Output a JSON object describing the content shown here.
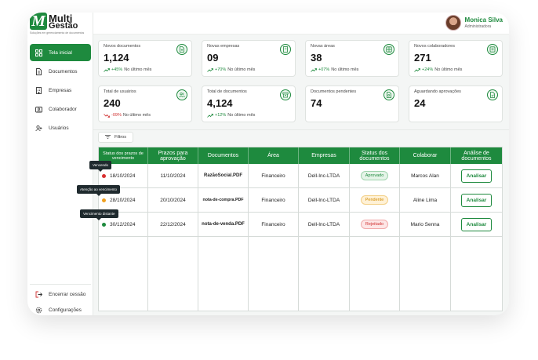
{
  "brand": {
    "logo_letter": "M",
    "name_line1": "Multi",
    "name_line2": "Gestão",
    "tagline": "Soluções em gerenciamento de documentos",
    "color": "#1e8a3e"
  },
  "user": {
    "name": "Monica Silva",
    "role": "Administradora"
  },
  "sidebar": {
    "items": [
      {
        "label": "Tela inicial",
        "icon": "grid-icon",
        "active": true
      },
      {
        "label": "Documentos",
        "icon": "document-icon",
        "active": false
      },
      {
        "label": "Empresas",
        "icon": "building-icon",
        "active": false
      },
      {
        "label": "Colaborador",
        "icon": "id-card-icon",
        "active": false
      },
      {
        "label": "Usuários",
        "icon": "user-add-icon",
        "active": false
      }
    ],
    "bottom": [
      {
        "label": "Encerrar cessão",
        "icon": "logout-icon"
      },
      {
        "label": "Configurações",
        "icon": "gear-icon"
      }
    ]
  },
  "cards": [
    {
      "title": "Novos documentos",
      "value": "1,124",
      "trend": "+45%",
      "trend_dir": "up",
      "period": "No último mês",
      "icon": "document-plus-icon"
    },
    {
      "title": "Novas empresas",
      "value": "09",
      "trend": "+70%",
      "trend_dir": "up",
      "period": "No último mês",
      "icon": "building-icon"
    },
    {
      "title": "Novas áreas",
      "value": "38",
      "trend": "+07%",
      "trend_dir": "up",
      "period": "No último mês",
      "icon": "grid-icon"
    },
    {
      "title": "Novos colaboradores",
      "value": "271",
      "trend": "+24%",
      "trend_dir": "up",
      "period": "No último mês",
      "icon": "id-card-icon"
    },
    {
      "title": "Total de usuários",
      "value": "240",
      "trend": "-09%",
      "trend_dir": "down",
      "period": "No último mês",
      "icon": "users-icon"
    },
    {
      "title": "Total de documentos",
      "value": "4,124",
      "trend": "+12%",
      "trend_dir": "up",
      "period": "No último mês",
      "icon": "archive-icon"
    },
    {
      "title": "Documentos pendentes",
      "value": "74",
      "trend": "",
      "trend_dir": "",
      "period": "",
      "icon": "document-search-icon"
    },
    {
      "title": "Aguardando aprovações",
      "value": "24",
      "trend": "",
      "trend_dir": "",
      "period": "",
      "icon": "document-check-icon"
    }
  ],
  "filters_label": "Filtros",
  "table": {
    "headers": [
      "Status dos prazos de vencimento",
      "Prazos para aprovação",
      "Documentos",
      "Área",
      "Empresas",
      "Status dos documentos",
      "Colaborar",
      "Análise de documentos"
    ],
    "rows": [
      {
        "due_date": "18/10/2024",
        "due_status": "overdue",
        "approval_date": "11/10/2024",
        "document": "RazãoSocial.PDF",
        "area": "Financeiro",
        "company": "Dell-Inc-LTDA",
        "status": "Aprovado",
        "status_type": "approved",
        "collaborator": "Marcos Alan",
        "action": "Analisar"
      },
      {
        "due_date": "28/10/2024",
        "due_status": "warning",
        "approval_date": "20/10/2024",
        "document": "nota-de-compra.PDF",
        "area": "Financeiro",
        "company": "Dell-Inc-LTDA",
        "status": "Pendente",
        "status_type": "pending",
        "collaborator": "Aline Lima",
        "action": "Analisar"
      },
      {
        "due_date": "30/12/2024",
        "due_status": "ok",
        "approval_date": "22/12/2024",
        "document": "nota-de-venda.PDF",
        "area": "Financeiro",
        "company": "Dell-Inc-LTDA",
        "status": "Rejeitado",
        "status_type": "rejected",
        "collaborator": "Mario Senna",
        "action": "Analisar"
      }
    ],
    "tooltips": [
      "Vencendo",
      "Atenção ao vencimento",
      "Vencimento distante"
    ]
  },
  "colors": {
    "primary": "#1e8a3e",
    "dot_overdue": "#d93030",
    "dot_warning": "#f0a020",
    "dot_ok": "#1e8a3e",
    "badge_approved_bg": "#e5f4e8",
    "badge_approved_fg": "#1e8a3e",
    "badge_pending_bg": "#fff1d6",
    "badge_pending_fg": "#d08a00",
    "badge_rejected_bg": "#fde6e6",
    "badge_rejected_fg": "#d03030"
  }
}
